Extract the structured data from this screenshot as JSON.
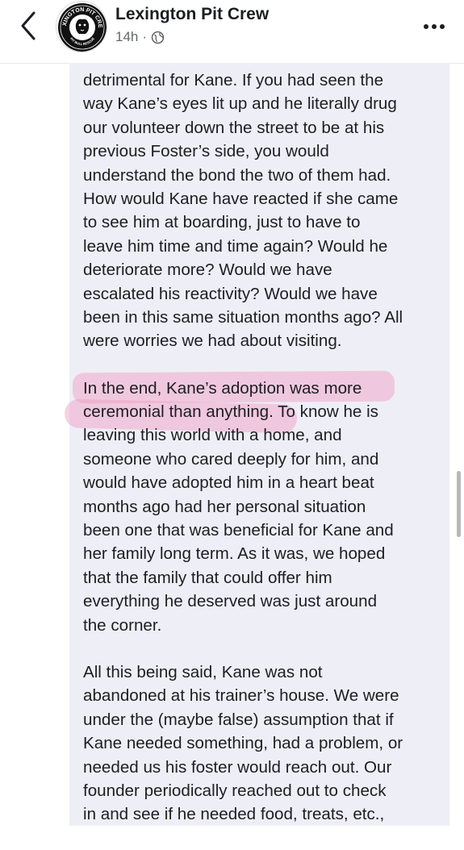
{
  "header": {
    "page_name": "Lexington Pit Crew",
    "time": "14h",
    "separator": "·",
    "privacy_icon": "globe-icon",
    "back_icon": "chevron-left-icon",
    "more_icon": "more-horizontal-icon",
    "avatar_logo_top_text": "LEXINGTON PIT CREW",
    "avatar_logo_bottom_text": "PIT BULL RESCUE"
  },
  "highlight_color": "#ef9ac4",
  "panel_color": "#eeeff6",
  "post": {
    "paragraphs": [
      {
        "lines": [
          "detrimental for Kane. If you had seen the",
          "way Kane’s eyes lit up and he literally drug",
          "our volunteer down the street to be at his",
          "previous Foster’s side, you would",
          "understand the bond the two of them had.",
          "How would Kane have reacted if she came",
          "to see him at boarding, just to have to",
          "leave him time and time again? Would he",
          "deteriorate more? Would we have",
          "escalated his reactivity? Would we have",
          "been in this same situation months ago? All",
          "were worries we had about visiting."
        ]
      },
      {
        "lines": [
          "In the end, Kane’s adoption was more",
          "ceremonial than anything. To know he is",
          "leaving this world with a home, and",
          "someone who cared deeply for him, and",
          "would have adopted him in a heart beat",
          "months ago had her personal situation",
          "been one that was beneficial for Kane and",
          "her family long term. As it was, we hoped",
          "that the family that could offer him",
          "everything he deserved was just around",
          "the corner."
        ]
      },
      {
        "lines": [
          "All this being said, Kane was not",
          "abandoned at his trainer’s house. We were",
          "under the (maybe false) assumption that if",
          "Kane needed something, had a problem, or",
          "needed us his foster would reach out. Our",
          "founder periodically reached out to check",
          "in and see if he needed food, treats, etc.,"
        ]
      }
    ]
  }
}
